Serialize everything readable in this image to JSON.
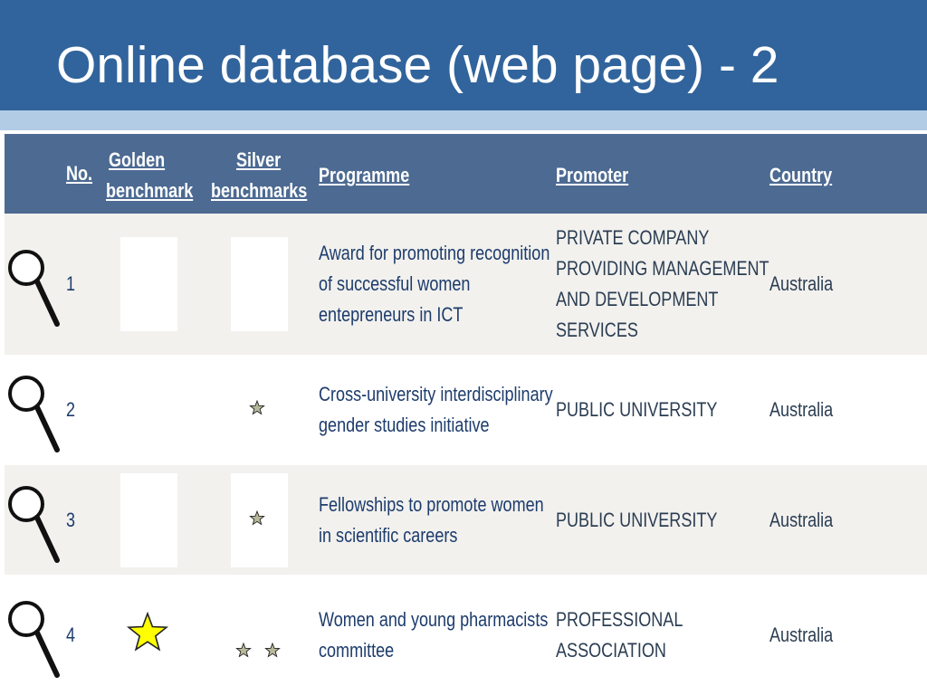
{
  "slide": {
    "title": "Online database (web page) - 2"
  },
  "table": {
    "headers": {
      "no": "No.",
      "golden_line1": "Golden",
      "golden_line2": "benchmark",
      "silver_line1": "Silver",
      "silver_line2": "benchmarks",
      "programme": "Programme",
      "promoter": "Promoter",
      "country": "Country"
    },
    "rows": [
      {
        "no": "1",
        "programme": [
          "Award for promoting recognition",
          "of successful women",
          "entepreneurs in ICT"
        ],
        "promoter": [
          "PRIVATE COMPANY",
          "PROVIDING MANAGEMENT",
          "AND DEVELOPMENT",
          "SERVICES"
        ],
        "country": "Australia",
        "golden_stars": 0,
        "silver_stars": 0
      },
      {
        "no": "2",
        "programme": [
          "Cross-university interdisciplinary",
          "gender studies initiative"
        ],
        "promoter": [
          "PUBLIC UNIVERSITY"
        ],
        "country": "Australia",
        "golden_stars": 0,
        "silver_stars": 1
      },
      {
        "no": "3",
        "programme": [
          "Fellowships to promote women",
          "in scientific careers"
        ],
        "promoter": [
          "PUBLIC UNIVERSITY"
        ],
        "country": "Australia",
        "golden_stars": 0,
        "silver_stars": 1
      },
      {
        "no": "4",
        "programme": [
          "Women and young pharmacists",
          "committee"
        ],
        "promoter": [
          "PROFESSIONAL",
          "ASSOCIATION"
        ],
        "country": "Australia",
        "golden_stars": 1,
        "silver_stars": 2
      }
    ]
  },
  "colors": {
    "title_bar": "#31649c",
    "accent_bar": "#b2cce6",
    "header_bg": "#4c6a92",
    "gold_star": "#ffff00",
    "silver_star": "#b8b89a"
  },
  "icons": {
    "row_detail": "magnifier-icon",
    "golden": "gold-star-icon",
    "silver": "silver-star-icon"
  }
}
